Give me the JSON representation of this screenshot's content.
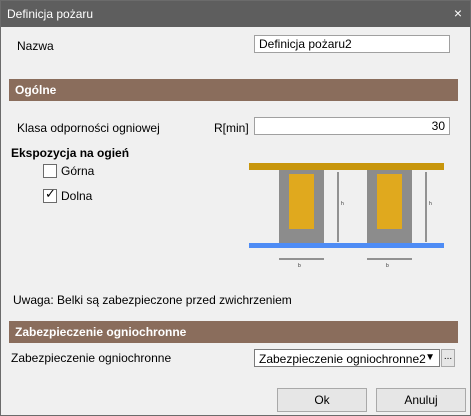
{
  "window": {
    "title": "Definicja pożaru",
    "close_glyph": "×"
  },
  "name": {
    "label": "Nazwa",
    "value": "Definicja pożaru2"
  },
  "section_general": "Ogólne",
  "fire_class": {
    "label": "Klasa odporności ogniowej",
    "unit": "R[min]",
    "value": "30"
  },
  "exposure": {
    "title": "Ekspozycja na ogień",
    "top_label": "Górna",
    "bottom_label": "Dolna",
    "top_checked": false,
    "bottom_checked": true
  },
  "diagram": {
    "h_label": "h",
    "b_label": "b"
  },
  "note": "Uwaga: Belki są zabezpieczone przed zwichrzeniem",
  "section_protection": "Zabezpieczenie ogniochronne",
  "protection": {
    "label": "Zabezpieczenie ogniochronne",
    "value": "Zabezpieczenie ogniochronne2",
    "more": "..."
  },
  "buttons": {
    "ok": "Ok",
    "cancel": "Anuluj"
  },
  "colors": {
    "titlebar": "#5e5e5e",
    "section": "#8a6d5c",
    "slab": "#c8960c",
    "insulation": "#e0a91e",
    "beam": "#8c8c8c",
    "floor": "#4e8cf5"
  }
}
